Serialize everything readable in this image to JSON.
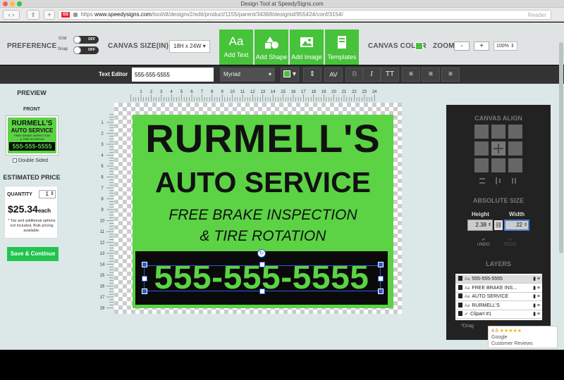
{
  "window": {
    "title": "Design Tool at SpeedySigns.com"
  },
  "browser": {
    "url_scheme": "https",
    "url_domain": "www.speedysigns.com",
    "url_path": "/tool/dt/designv2/edit/product/1155/parent/34368/designid/955424/conf/3154/",
    "reader_label": "Reader"
  },
  "toolbar": {
    "preference_label": "PREFERENCE",
    "grid_label": "Grid",
    "snap_label": "Snap",
    "grid_state": "OFF",
    "snap_state": "OFF",
    "canvas_size_label": "CANVAS SIZE(IN)",
    "canvas_size_value": "18H x 24W",
    "add_text_label": "Add Text",
    "add_shape_label": "Add Shape",
    "add_image_label": "Add Image",
    "templates_label": "Templates",
    "text_icon": "Aa",
    "canvas_color_label": "CANVAS COLOR",
    "canvas_color": "#47c23b",
    "zoom_label": "ZOOM",
    "zoom_minus": "-",
    "zoom_plus": "+",
    "zoom_value": "100%"
  },
  "editor_bar": {
    "text_editor_label": "Text Editor",
    "text_value": "555-555-5555",
    "font_value": "Myriad",
    "text_color": "#47c23b",
    "spacing_label": "AV",
    "bold_label": "B",
    "italic_label": "I",
    "caps_label": "TT"
  },
  "left_panel": {
    "preview_label": "PREVIEW",
    "front_label": "FRONT",
    "double_sided_label": "Double Sided",
    "estimated_price_label": "ESTIMATED PRICE",
    "quantity_label": "QUANTITY",
    "quantity_value": "1",
    "price": "$25.34",
    "price_unit": "each",
    "tax_note": "* Tax and additional options not included, Bulk pricing available.",
    "save_button": "Save & Continue"
  },
  "sign": {
    "background": "#5bd345",
    "line1": "RURMELL'S",
    "line2": "AUTO SERVICE",
    "line3": "FREE BRAKE INSPECTION",
    "line4": "& TIRE ROTATION",
    "phone": "555-555-5555"
  },
  "rulers": {
    "top": [
      "1",
      "2",
      "3",
      "4",
      "5",
      "6",
      "7",
      "8",
      "9",
      "10",
      "11",
      "12",
      "13",
      "14",
      "15",
      "16",
      "17",
      "18",
      "19",
      "20",
      "21",
      "22",
      "23",
      "24"
    ],
    "left": [
      "1",
      "2",
      "3",
      "4",
      "5",
      "6",
      "7",
      "8",
      "9",
      "10",
      "11",
      "12",
      "13",
      "14",
      "15",
      "16",
      "17",
      "18"
    ]
  },
  "right_panel": {
    "canvas_align_label": "CANVAS ALIGN",
    "absolute_size_label": "ABSOLUTE SIZE",
    "height_label": "Height",
    "width_label": "Width",
    "height_value": "2.38",
    "width_value": "22",
    "undo_label": "UNDO",
    "redo_label": "REDO",
    "layers_label": "LAYERS",
    "layers": [
      "555-555-5555",
      "FREE BRAKE INS...",
      "AUTO SERVICE",
      "RURMELL'S",
      "Clipart #1"
    ],
    "drag_hint": "*Drag"
  },
  "reviews": {
    "rating": "4.6",
    "stars": "★★★★★",
    "brand": "Google",
    "label": "Customer Reviews"
  }
}
